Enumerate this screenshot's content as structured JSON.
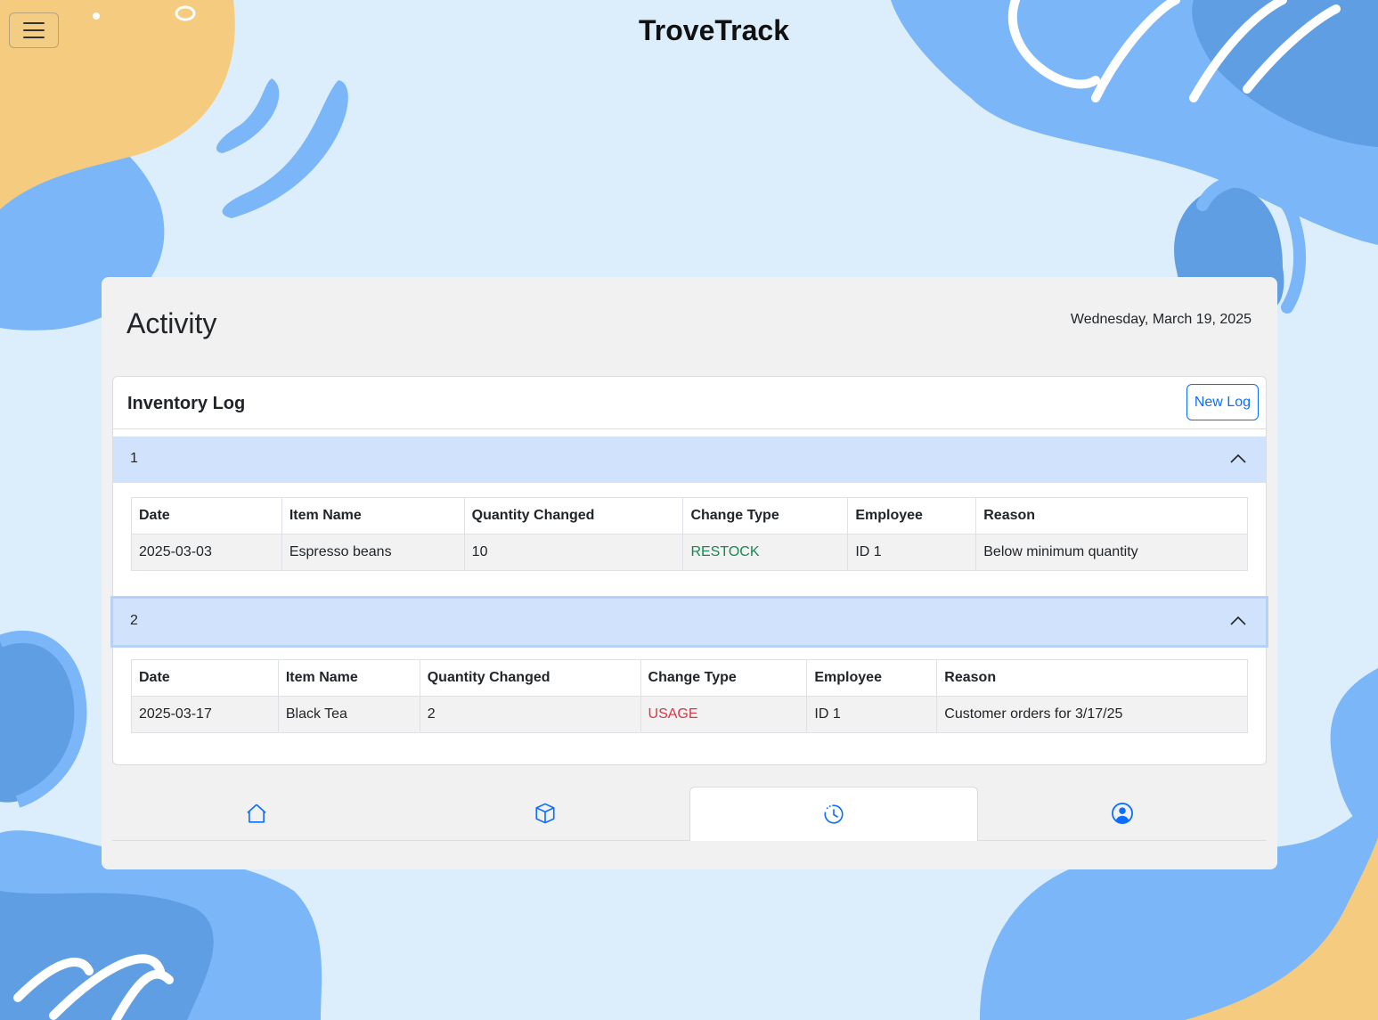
{
  "app": {
    "title": "TroveTrack"
  },
  "page": {
    "title": "Activity",
    "date": "Wednesday, March 19, 2025"
  },
  "log": {
    "title": "Inventory Log",
    "new_log_label": "New Log",
    "columns": [
      "Date",
      "Item Name",
      "Quantity Changed",
      "Change Type",
      "Employee",
      "Reason"
    ],
    "entries": [
      {
        "id": "1",
        "date": "2025-03-03",
        "item": "Espresso beans",
        "quantity": "10",
        "change_type": "RESTOCK",
        "employee": "ID 1",
        "reason": "Below minimum quantity"
      },
      {
        "id": "2",
        "date": "2025-03-17",
        "item": "Black Tea",
        "quantity": "2",
        "change_type": "USAGE",
        "employee": "ID 1",
        "reason": "Customer orders for 3/17/25"
      }
    ]
  },
  "tabs": [
    {
      "icon": "home-icon",
      "active": false
    },
    {
      "icon": "box-icon",
      "active": false
    },
    {
      "icon": "clock-history-icon",
      "active": true
    },
    {
      "icon": "person-circle-icon",
      "active": false
    }
  ],
  "colors": {
    "accent": "#0d6efd",
    "restock": "#198754",
    "usage": "#dc3545",
    "accordion_header": "#d0e2fc",
    "background": "#dceefc",
    "blob_blue": "#7ab6f8",
    "blob_dark_blue": "#5f9ee2",
    "blob_orange": "#f4cb7f"
  }
}
